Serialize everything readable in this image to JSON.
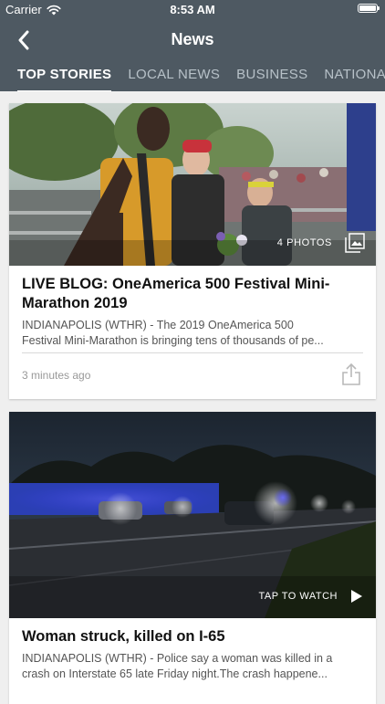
{
  "status_bar": {
    "carrier": "Carrier",
    "time": "8:53 AM"
  },
  "nav": {
    "title": "News"
  },
  "tabs": [
    {
      "label": "TOP STORIES",
      "active": true
    },
    {
      "label": "LOCAL NEWS",
      "active": false
    },
    {
      "label": "BUSINESS",
      "active": false
    },
    {
      "label": "NATIONAL",
      "active": false
    }
  ],
  "articles": [
    {
      "title": "LIVE BLOG: OneAmerica 500 Festival Mini-Marathon 2019",
      "summary_line1": "INDIANAPOLIS (WTHR) - The 2019 OneAmerica 500",
      "summary_line2": "Festival Mini-Marathon is bringing tens of thousands of pe...",
      "media_label": "4 PHOTOS",
      "media_icon": "gallery-icon",
      "timestamp": "3 minutes ago"
    },
    {
      "title": "Woman struck, killed on I-65",
      "summary_line1": "INDIANAPOLIS (WTHR) - Police say a woman was killed in a",
      "summary_line2": "crash on Interstate 65 late Friday night.The crash happene...",
      "media_label": "TAP TO WATCH",
      "media_icon": "play-icon"
    }
  ],
  "colors": {
    "header_bg": "#4e5962",
    "tab_inactive": "#b7c1c8",
    "page_bg": "#efefef"
  }
}
